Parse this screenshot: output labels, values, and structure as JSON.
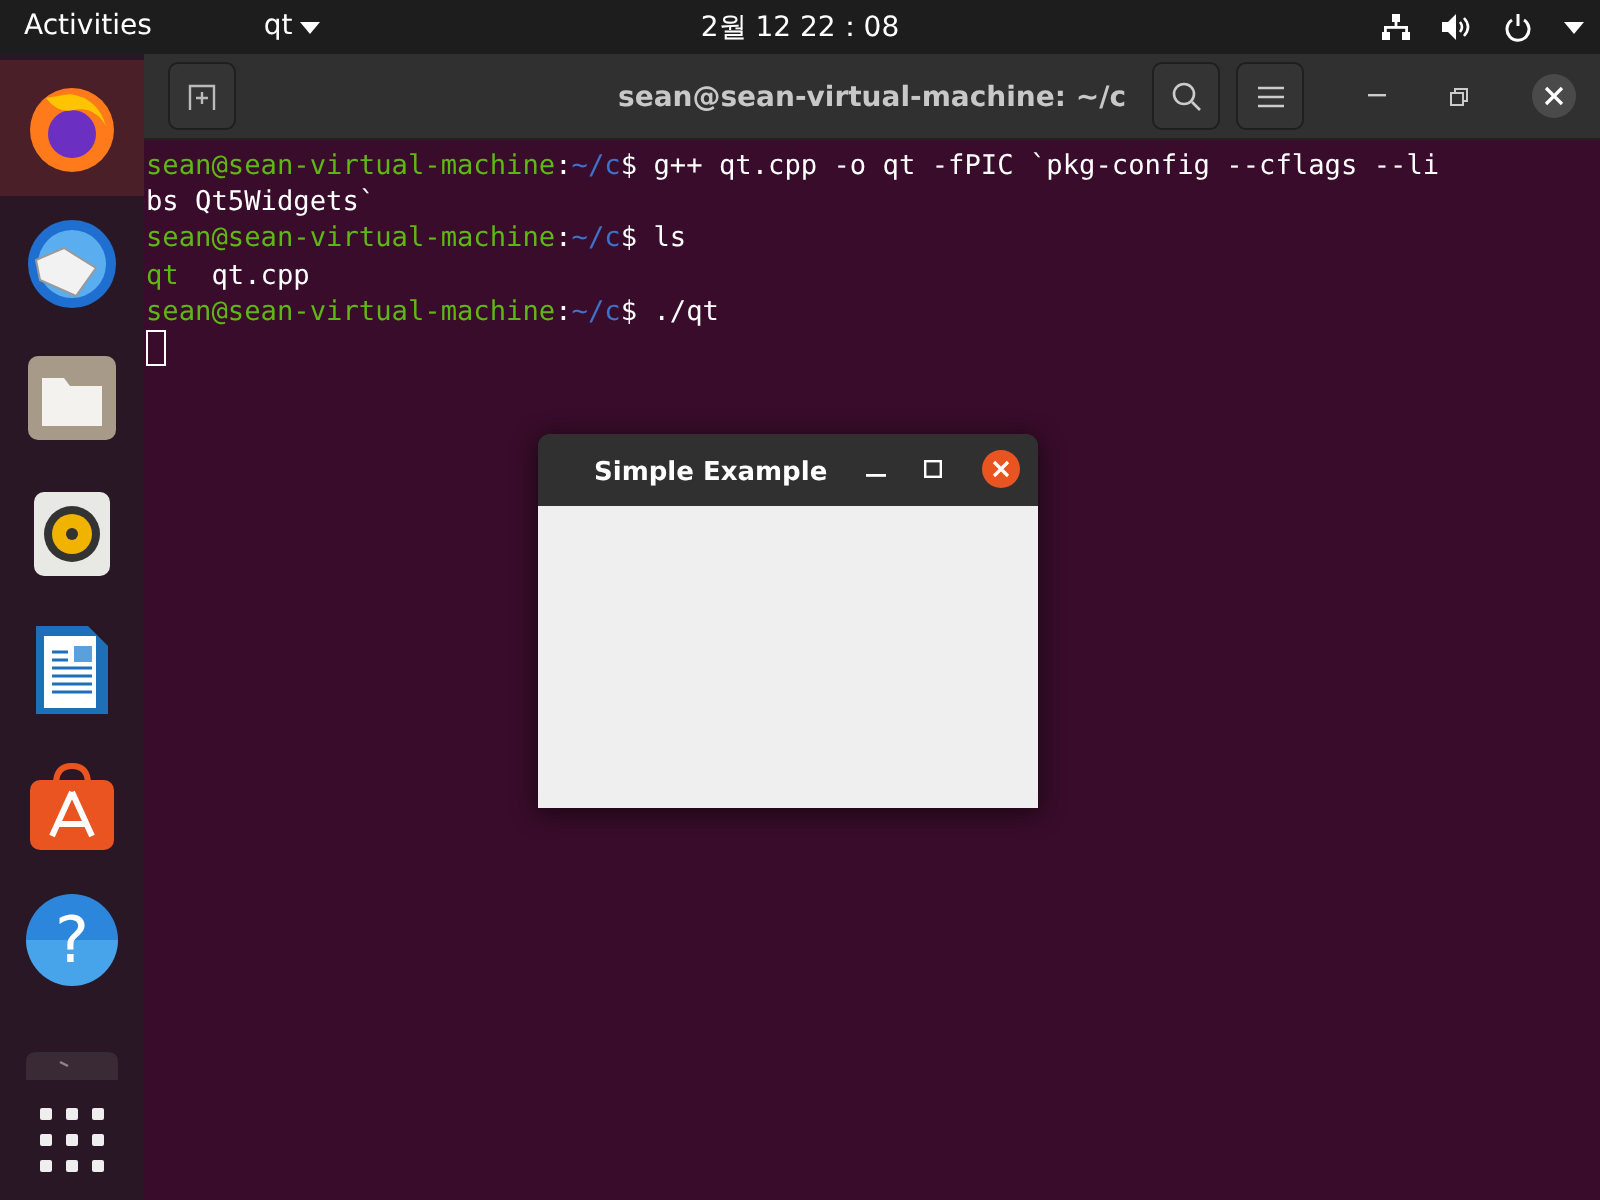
{
  "top_bar": {
    "activities": "Activities",
    "app_menu": "qt",
    "clock": "2월 12  22：08"
  },
  "dock": {
    "items": [
      {
        "kind": "browser",
        "selected": true
      },
      {
        "kind": "mail",
        "selected": false
      },
      {
        "kind": "files",
        "selected": false
      },
      {
        "kind": "music",
        "selected": false
      },
      {
        "kind": "writer",
        "selected": false
      },
      {
        "kind": "store",
        "selected": false
      },
      {
        "kind": "help",
        "selected": false,
        "glyph": "?"
      },
      {
        "kind": "terminal",
        "selected": false
      },
      {
        "kind": "apps",
        "selected": false
      }
    ]
  },
  "terminal": {
    "title": "sean@sean-virtual-machine: ~/c",
    "lines": [
      {
        "segments": [
          {
            "kind": "user",
            "text": "sean@sean-virtual-machine"
          },
          {
            "kind": "plain",
            "text": ":"
          },
          {
            "kind": "path",
            "text": "~/c"
          },
          {
            "kind": "plain",
            "text": "$ g++ qt.cpp -o qt -fPIC `pkg-config --cflags --li"
          }
        ]
      },
      {
        "segments": [
          {
            "kind": "plain",
            "text": "bs Qt5Widgets`"
          }
        ]
      },
      {
        "segments": [
          {
            "kind": "user",
            "text": "sean@sean-virtual-machine"
          },
          {
            "kind": "plain",
            "text": ":"
          },
          {
            "kind": "path",
            "text": "~/c"
          },
          {
            "kind": "plain",
            "text": "$ ls"
          }
        ]
      },
      {
        "segments": [
          {
            "kind": "user",
            "text": "qt"
          },
          {
            "kind": "plain",
            "text": "  qt.cpp"
          }
        ]
      },
      {
        "segments": [
          {
            "kind": "user",
            "text": "sean@sean-virtual-machine"
          },
          {
            "kind": "plain",
            "text": ":"
          },
          {
            "kind": "path",
            "text": "~/c"
          },
          {
            "kind": "plain",
            "text": "$ ./qt"
          }
        ]
      }
    ]
  },
  "qt_window": {
    "title": "Simple Example"
  }
}
